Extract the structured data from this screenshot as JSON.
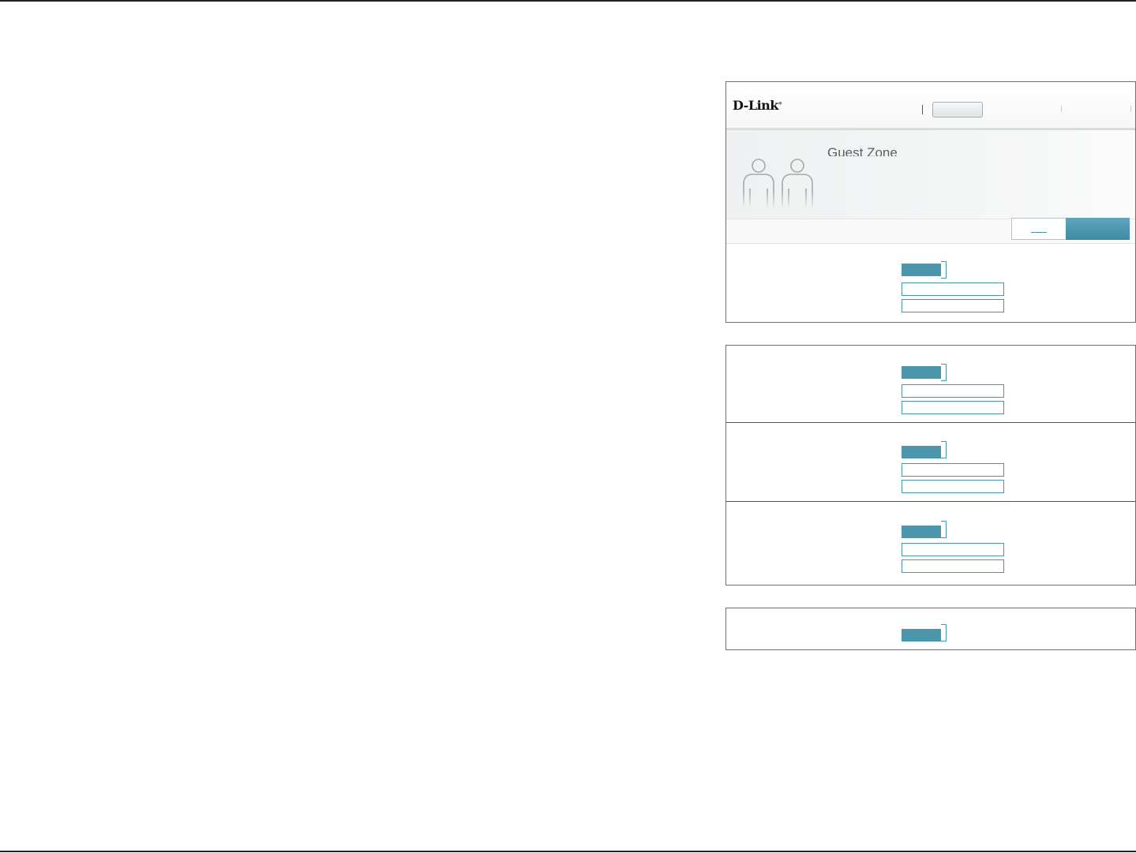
{
  "brand": {
    "logo_text": "D-Link",
    "reg_mark": "®"
  },
  "page": {
    "title": "Guest Zone"
  },
  "colors": {
    "accent": "#4a97ac",
    "save_button": "#3f8aa3",
    "border": "#6d6d6d"
  },
  "icons": {
    "hero": "guest-users-icon"
  }
}
